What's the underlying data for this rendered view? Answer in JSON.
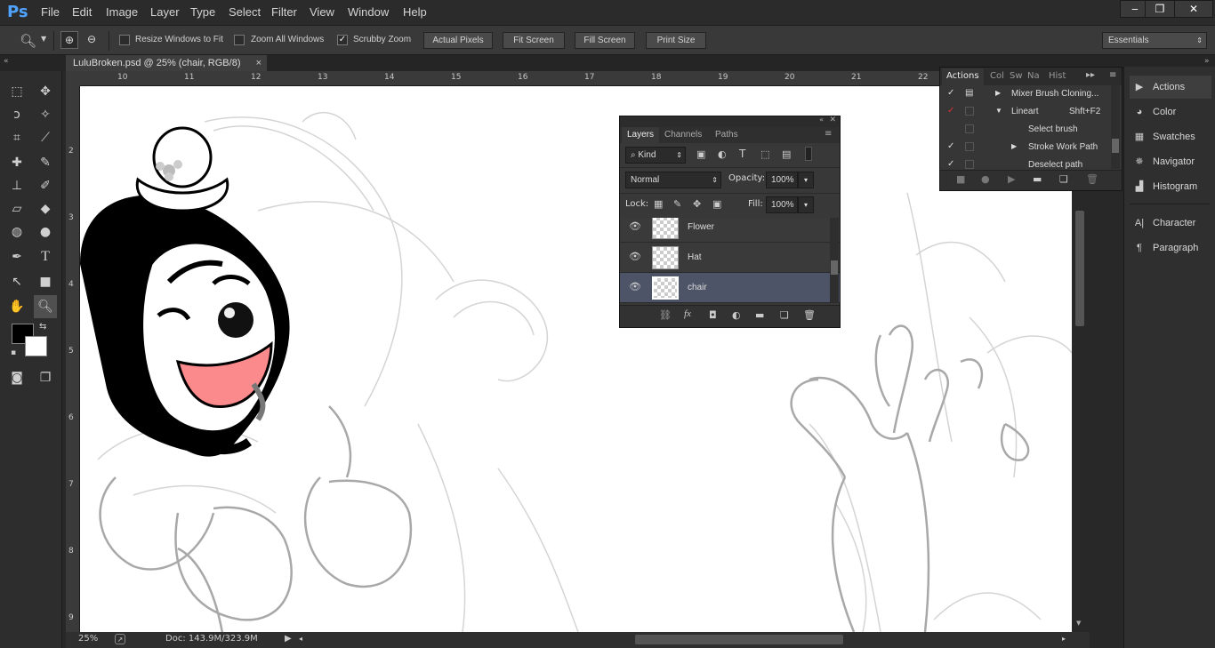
{
  "app": {
    "logo": "Ps"
  },
  "menu": [
    "File",
    "Edit",
    "Image",
    "Layer",
    "Type",
    "Select",
    "Filter",
    "View",
    "Window",
    "Help"
  ],
  "window_controls": {
    "minimize": "‒",
    "restore": "❐",
    "close": "✕"
  },
  "options_bar": {
    "resize_windows_label": "Resize Windows to Fit",
    "zoom_all_label": "Zoom All Windows",
    "scrubby_zoom_label": "Scrubby Zoom",
    "actual_pixels": "Actual Pixels",
    "fit_screen": "Fit Screen",
    "fill_screen": "Fill Screen",
    "print_size": "Print Size",
    "workspace": "Essentials",
    "scrubby_checked": true
  },
  "document": {
    "tab_title": "LuluBroken.psd @ 25% (chair, RGB/8)",
    "close": "×"
  },
  "rulers": {
    "horizontal": [
      "10",
      "11",
      "12",
      "13",
      "14",
      "15",
      "16",
      "17",
      "18",
      "19",
      "20",
      "21",
      "22"
    ],
    "vertical": [
      "2",
      "3",
      "4",
      "5",
      "6",
      "7",
      "8",
      "9"
    ]
  },
  "status": {
    "zoom": "25%",
    "doc": "Doc: 143.9M/323.9M"
  },
  "layers_panel": {
    "tabs": [
      "Layers",
      "Channels",
      "Paths"
    ],
    "kind": "Kind",
    "blend_mode": "Normal",
    "opacity_label": "Opacity:",
    "opacity": "100%",
    "lock_label": "Lock:",
    "fill_label": "Fill:",
    "fill": "100%",
    "layers": [
      {
        "name": "Flower",
        "selected": false
      },
      {
        "name": "Hat",
        "selected": false
      },
      {
        "name": "chair",
        "selected": true
      }
    ]
  },
  "actions_panel": {
    "tabs": [
      "Actions",
      "Col",
      "Sw",
      "Na",
      "Hist"
    ],
    "rows": [
      {
        "checked": true,
        "expanded": false,
        "indent": 0,
        "label": "Mixer Brush Cloning...",
        "shortcut": ""
      },
      {
        "checked": true,
        "expanded": true,
        "indent": 0,
        "label": "Lineart",
        "shortcut": "Shft+F2"
      },
      {
        "checked": false,
        "expanded": false,
        "indent": 1,
        "label": "Select brush",
        "shortcut": ""
      },
      {
        "checked": true,
        "expanded": false,
        "indent": 1,
        "label": "Stroke Work Path",
        "shortcut": ""
      },
      {
        "checked": true,
        "expanded": false,
        "indent": 1,
        "label": "Deselect path",
        "shortcut": ""
      }
    ]
  },
  "right_dock": [
    {
      "label": "Actions",
      "icon": "play-icon"
    },
    {
      "label": "Color",
      "icon": "palette-icon"
    },
    {
      "label": "Swatches",
      "icon": "grid-icon"
    },
    {
      "label": "Navigator",
      "icon": "compass-icon"
    },
    {
      "label": "Histogram",
      "icon": "histogram-icon"
    },
    {
      "label": "Character",
      "icon": "character-icon"
    },
    {
      "label": "Paragraph",
      "icon": "paragraph-icon"
    }
  ]
}
